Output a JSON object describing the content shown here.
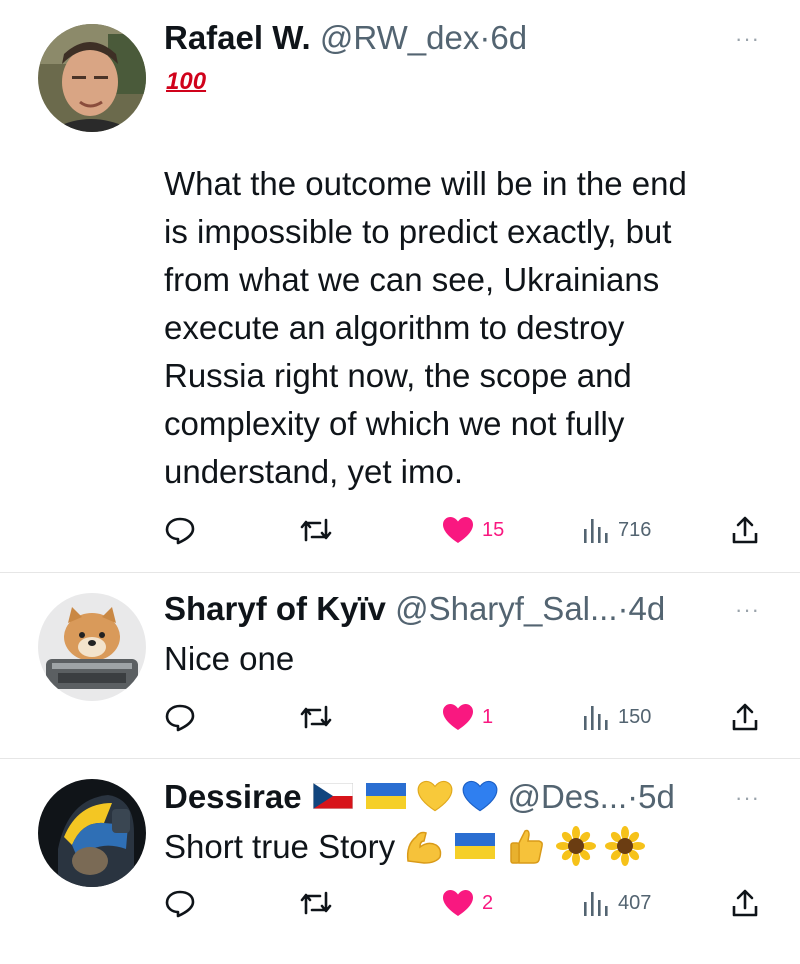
{
  "tweets": [
    {
      "name": "Rafael W.",
      "handle": "@RW_dex",
      "sep": "·",
      "age": "6d",
      "badge": "100",
      "text": "What the outcome will be in the end\nis impossible to predict exactly, but\nfrom what we can see, Ukrainians\nexecute an algorithm to destroy\nRussia right now, the scope and\ncomplexity of which we not fully\nunderstand, yet imo.",
      "likes": "15",
      "views": "716"
    },
    {
      "name": "Sharyf of Kyïv",
      "handle": "@Sharyf_Sal...",
      "sep": "·",
      "age": "4d",
      "text": "Nice one",
      "likes": "1",
      "views": "150"
    },
    {
      "name": "Dessirae",
      "handle": "@Des...",
      "sep": "·",
      "age": "5d",
      "text": "Short true Story",
      "likes": "2",
      "views": "407"
    }
  ],
  "more_label": "···",
  "colors": {
    "like": "#f91880",
    "text": "#0f1419",
    "muted": "#536471"
  }
}
